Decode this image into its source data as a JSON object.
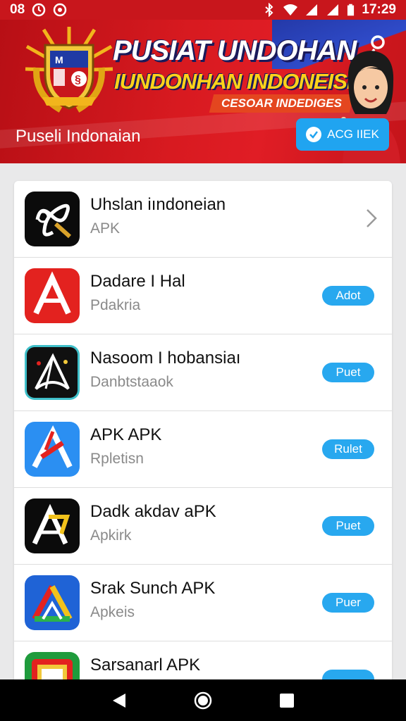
{
  "status_bar": {
    "left_text": "08",
    "time": "17:29",
    "icons": [
      "clock-icon",
      "sync-icon",
      "bluetooth-icon",
      "wifi-icon",
      "signal-icon",
      "signal-icon",
      "battery-icon"
    ]
  },
  "banner": {
    "title_line1": "PUSIAT UNDOHAN",
    "title_line2": "IUNDONHAN INDONEISIA",
    "subtitle": "CESOAR INDEDIGES",
    "label": "Puseli Indonaian",
    "cta_label": "ACG IIEK",
    "emblem_text": "M  §",
    "colors": {
      "red": "#d81a20",
      "blue": "#2f4bc9",
      "yellow": "#ffd21a",
      "cta": "#20a4f0"
    }
  },
  "apps": [
    {
      "name": "Uhslan iındoneian",
      "sub": "APK",
      "action": "",
      "icon": "infinity-ribbon-icon",
      "action_type": "chevron"
    },
    {
      "name": "Dadare I Hal",
      "sub": "Pdakria",
      "action": "Adot",
      "icon": "red-a-icon",
      "action_type": "pill"
    },
    {
      "name": "Nasoom I hobansiaı",
      "sub": "Danbtstaaok",
      "action": "Puet",
      "icon": "black-a-teal-icon",
      "action_type": "pill"
    },
    {
      "name": "APK APK",
      "sub": "Rpletisn",
      "action": "Rulet",
      "icon": "blue-a-red-icon",
      "action_type": "pill"
    },
    {
      "name": "Dadk akdav aPK",
      "sub": "Apkirk",
      "action": "Puet",
      "icon": "black-a-yellow-icon",
      "action_type": "pill"
    },
    {
      "name": "Srak Sunch APK",
      "sub": "Apkeis",
      "action": "Puer",
      "icon": "blue-a-colorful-icon",
      "action_type": "pill"
    },
    {
      "name": "Sarsanarl APK",
      "sub": "",
      "action": "",
      "icon": "green-emblem-icon",
      "action_type": "pill"
    }
  ]
}
